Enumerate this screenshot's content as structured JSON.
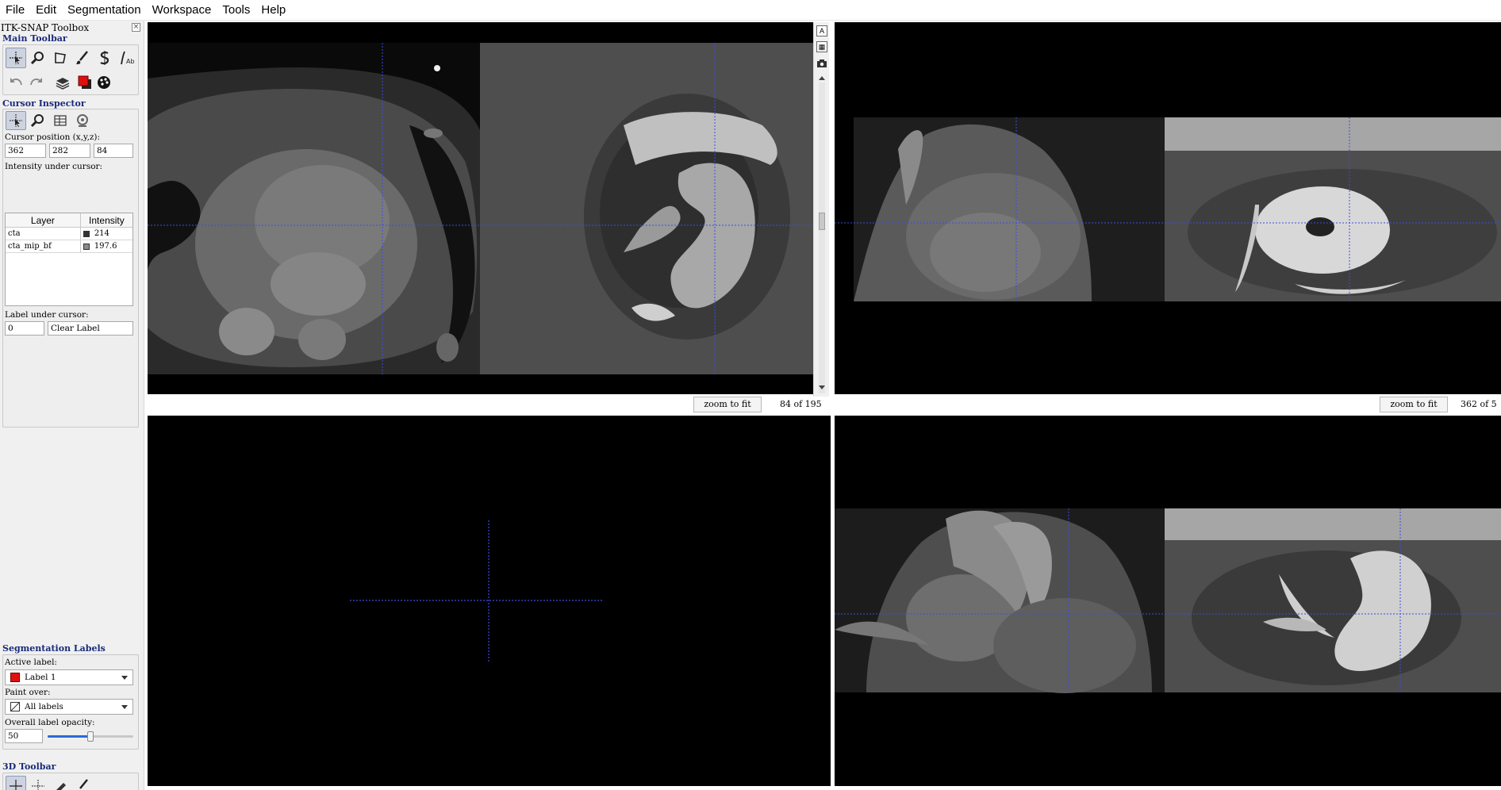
{
  "menu": [
    "File",
    "Edit",
    "Segmentation",
    "Workspace",
    "Tools",
    "Help"
  ],
  "toolbox": {
    "title": "ITK-SNAP Toolbox",
    "close_glyph": "×",
    "main_toolbar_title": "Main Toolbar",
    "main_tools": [
      "crosshair-tool",
      "zoom-tool",
      "polygon-tool",
      "paintbrush-tool",
      "snake-tool",
      "annotation-tool"
    ],
    "action_tools": [
      "undo",
      "redo",
      "layers",
      "label-color",
      "palette"
    ],
    "cursor_inspector": {
      "title": "Cursor Inspector",
      "position_label": "Cursor position (x,y,z):",
      "x": "362",
      "y": "282",
      "z": "84",
      "intensity_label": "Intensity under cursor:",
      "headers": [
        "Layer",
        "Intensity"
      ],
      "rows": [
        {
          "layer": "cta",
          "intensity": "214",
          "swatch": "#333333"
        },
        {
          "layer": "cta_mip_bf",
          "intensity": "197.6",
          "swatch": "#8a8a8a"
        }
      ],
      "label_under_cursor_label": "Label under cursor:",
      "label_id": "0",
      "label_name": "Clear Label"
    },
    "segmentation_labels": {
      "title": "Segmentation Labels",
      "active_label_label": "Active label:",
      "active_label": "Label 1",
      "active_color": "#e01010",
      "paint_over_label": "Paint over:",
      "paint_over": "All labels",
      "opacity_label": "Overall label opacity:",
      "opacity_value": "50",
      "opacity_fraction": 0.5
    },
    "toolbar_3d_title": "3D Toolbar"
  },
  "views": {
    "axial": {
      "zoom_button": "zoom to fit",
      "slice": "84 of 195"
    },
    "sagittal": {
      "zoom_button": "zoom to fit",
      "slice": "362 of 5"
    }
  },
  "colors": {
    "crosshair": "#3a4ee0",
    "toolbox_section": "#1a2a7a"
  }
}
